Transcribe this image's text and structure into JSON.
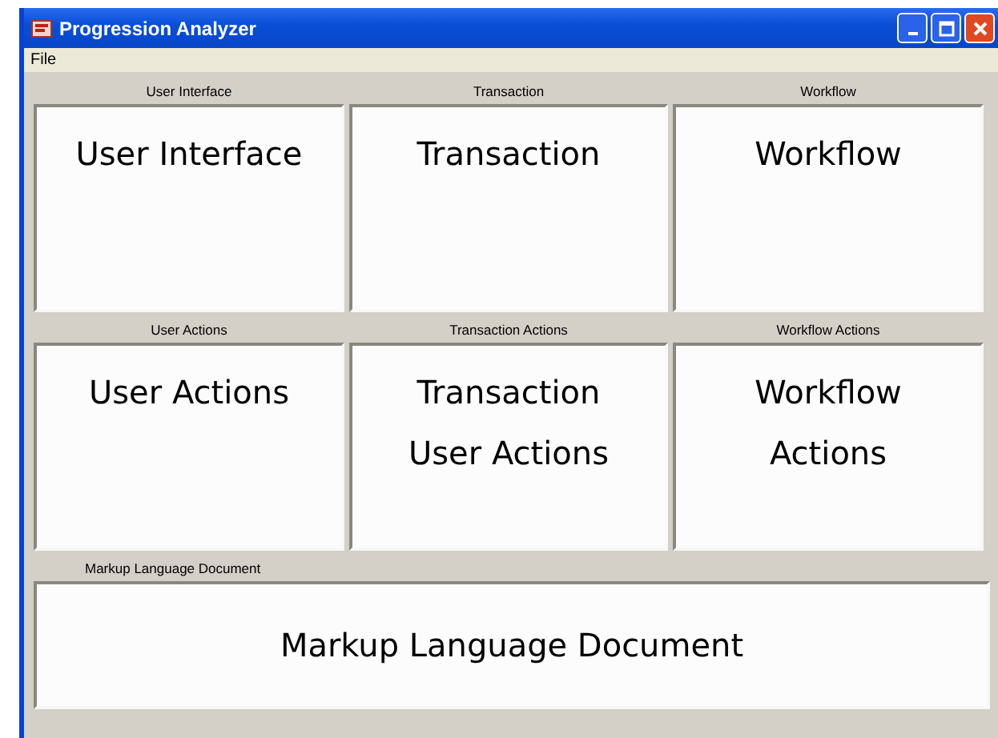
{
  "window": {
    "title": "Progression Analyzer"
  },
  "menu": [
    "File"
  ],
  "panels": [
    {
      "label": "User Interface",
      "lines": [
        "User Interface"
      ]
    },
    {
      "label": "Transaction",
      "lines": [
        "Transaction"
      ]
    },
    {
      "label": "Workflow",
      "lines": [
        "Workflow"
      ]
    },
    {
      "label": "User Actions",
      "lines": [
        "User Actions"
      ]
    },
    {
      "label": "Transaction Actions",
      "lines": [
        "Transaction",
        "User Actions"
      ]
    },
    {
      "label": "Workflow Actions",
      "lines": [
        "Workflow",
        "Actions"
      ]
    }
  ],
  "document": {
    "label": "Markup Language Document",
    "lines": [
      "Markup Language Document"
    ]
  }
}
